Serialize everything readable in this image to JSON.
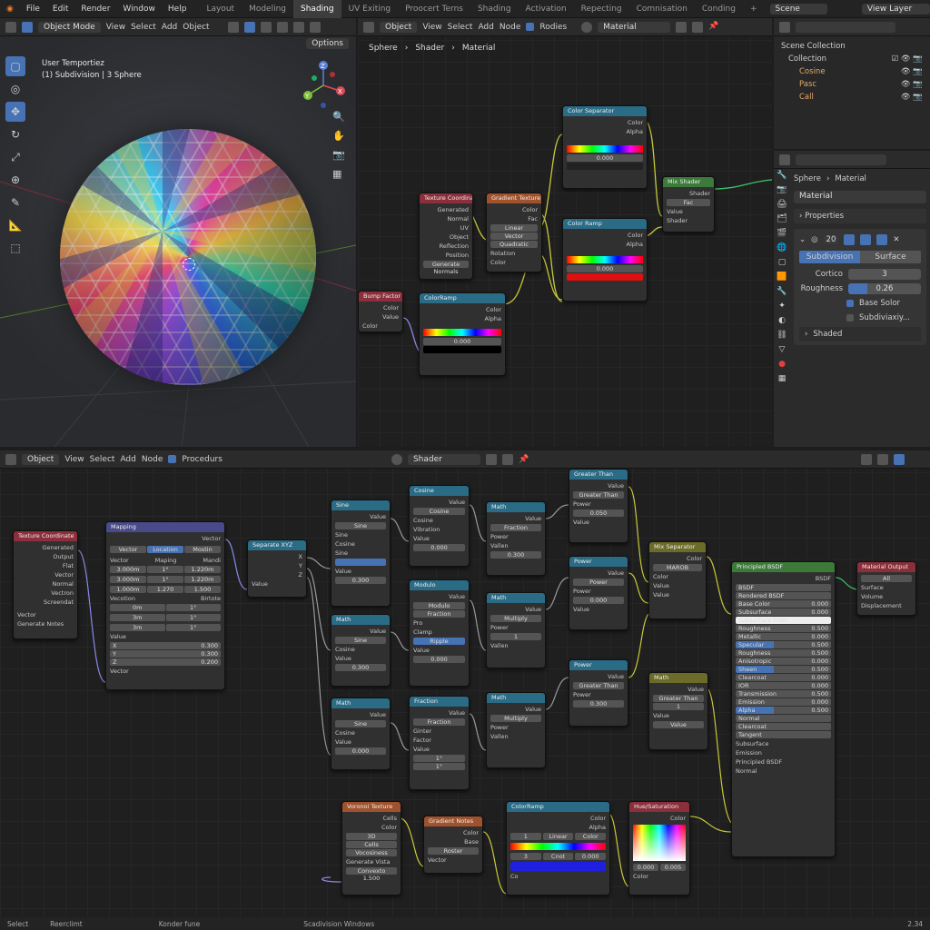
{
  "topbar": {
    "menus": [
      "File",
      "Edit",
      "Render",
      "Window",
      "Help"
    ],
    "workspaces": [
      "Layout",
      "Modeling",
      "Shading",
      "UV Exiting",
      "Proocert Terns",
      "Shading",
      "Activation",
      "Repecting",
      "Comnisation",
      "Conding"
    ],
    "active_workspace_index": 2,
    "plus": "+",
    "scene": "Scene",
    "view_layer": "View Layer"
  },
  "viewport": {
    "mode": "Object Mode",
    "menus": [
      "View",
      "Select",
      "Add",
      "Object"
    ],
    "options": "Options",
    "info_line1": "User Temportiez",
    "info_line2": "(1) Subdivision | 3 Sphere",
    "gizmo": {
      "x": "X",
      "y": "Y",
      "z": "Z"
    }
  },
  "shader_top": {
    "mode": "Object",
    "menus": [
      "View",
      "Select",
      "Add",
      "Node"
    ],
    "checkbox": "Rodies",
    "material": "Material",
    "breadcrumb": [
      "Sphere",
      "Shader",
      "Material"
    ]
  },
  "outliner": {
    "title": "Scene Collection",
    "collection": "Collection",
    "items": [
      "Cosine",
      "Pasc",
      "Call"
    ]
  },
  "properties": {
    "breadcrumb": [
      "Sphere",
      "Material"
    ],
    "material": "Material",
    "section": "Properties",
    "count": "20",
    "tabs": [
      "Subdivision",
      "Surface"
    ],
    "cortico_label": "Cortico",
    "cortico_value": "3",
    "roughness_label": "Roughness",
    "roughness_value": "0.26",
    "base_solor": "Base Solor",
    "subdiv": "Subdiviaxiy...",
    "shaded": "Shaded"
  },
  "shader_bottom": {
    "mode": "Object",
    "menus": [
      "View",
      "Select",
      "Add",
      "Node"
    ],
    "procedurs": "Procedurs",
    "shader": "Shader"
  },
  "top_nodes": {
    "n1": {
      "title": "Texture Coordinate",
      "rows": [
        "Generated",
        "Normal",
        "UV",
        "Object",
        "Reflection",
        "Position"
      ],
      "btn": "Generate Normals"
    },
    "n2": {
      "title": "Gradient Texture",
      "rows": [
        "Color",
        "Fac",
        "Linear",
        "Vector",
        "Quadratic",
        "Vector",
        "Rotation",
        "Color"
      ]
    },
    "n3": {
      "title": "Color Separator",
      "rows": [
        "Color",
        "Alpha"
      ],
      "ramp_vals": [
        "1",
        "Linear",
        "0.000"
      ]
    },
    "n4": {
      "title": "Color Ramp",
      "rows": [
        "Color",
        "Alpha"
      ],
      "ramp_vals": [
        "1",
        "Cnst",
        "0.000"
      ]
    },
    "n5": {
      "title": "ColorRamp",
      "rows": [
        "Color",
        "Alpha"
      ],
      "ramp_vals": [
        "1",
        "Base",
        "0.000"
      ]
    },
    "n6": {
      "title": "Mix Shader",
      "rows": [
        "Shader",
        "Fac",
        "Shader",
        "Value",
        "Shader"
      ]
    },
    "n7": {
      "title": "Bump Factor",
      "rows": [
        "Color",
        "Value",
        "Color"
      ]
    }
  },
  "bottom_nodes": {
    "texcoord": {
      "title": "Texture Coordinate",
      "rows": [
        "Generated",
        "Output",
        "Flat",
        "Vector",
        "Normal",
        "Vectron",
        "Screendat"
      ],
      "vector": "Vector",
      "chk": "Generate Notes"
    },
    "mapping": {
      "title": "Mapping",
      "out": "Vector",
      "tabs": [
        "Vector",
        "Location",
        "Mostin"
      ],
      "loc": "Vector",
      "rot": "Maping",
      "scale": "Mandi",
      "vals": [
        "3.000m",
        "3.000m",
        "1.000m",
        "1.270",
        "1.220m",
        "1.500"
      ],
      "rotlabel": "Vecotion",
      "scalelabel": "Birtote",
      "xyz": [
        "X",
        "Y",
        "Z"
      ],
      "rvals": [
        "0m",
        "3m",
        "3m"
      ],
      "svals": [
        "1°",
        "1°",
        "1°"
      ],
      "value": "Value",
      "fields": [
        "X",
        "Y",
        "Z"
      ],
      "fvals": [
        "0.300",
        "0.300",
        "0.200"
      ],
      "vector": "Vector"
    },
    "separate": {
      "title": "Separate XYZ",
      "out": [
        "X",
        "Y",
        "Z"
      ],
      "in": "Value"
    },
    "math_col1": [
      {
        "title": "Sine",
        "op": "Sine",
        "rows": [
          "Sine",
          "Cosine",
          "Sine"
        ],
        "val": "Value",
        "field": "0.300"
      },
      {
        "title": "Math",
        "op": "Sine",
        "rows": [
          "Cosine"
        ],
        "val": "Value",
        "field": "0.300"
      },
      {
        "title": "Math",
        "op": "Sine",
        "rows": [
          "Cosine"
        ],
        "val": "Value",
        "field": "0.000"
      }
    ],
    "math_col2": [
      {
        "title": "Cosine",
        "op": "Cosine",
        "rows": [
          "Cosine",
          "Vibration",
          "Value"
        ],
        "field": "0.000"
      },
      {
        "title": "Modulo",
        "op": "Modulo",
        "rows": [
          "Fraction",
          "Pro",
          "Clamp",
          "Ripple"
        ],
        "field": "0.000"
      },
      {
        "title": "Fraction",
        "op": "Fraction",
        "rows": [
          "Ginter",
          "Factor",
          "Value"
        ],
        "field": "1°"
      }
    ],
    "math_col3": [
      {
        "title": "Math",
        "op": "Fraction",
        "rows": [
          "Power",
          "Vallen"
        ],
        "field": "0.300"
      },
      {
        "title": "Math",
        "op": "Multiply",
        "rows": [
          "Power",
          "Vallen"
        ],
        "field": "1"
      },
      {
        "title": "Math",
        "op": "Multiply",
        "rows": [
          "Power",
          "Vallen"
        ],
        "field": ""
      }
    ],
    "compare": [
      {
        "title": "Greater Than",
        "op": "Greater Than",
        "rows": [
          "Power",
          "Value"
        ],
        "field": "0.050"
      },
      {
        "title": "Power",
        "op": "Power",
        "rows": [
          "Power",
          "Value"
        ],
        "field": "0.000"
      },
      {
        "title": "Power",
        "op": "Greater Than",
        "rows": [
          "Power",
          "Value"
        ],
        "field": "0.300"
      }
    ],
    "mix1": {
      "title": "Mix Separator",
      "rows": [
        "Color",
        "MAROB",
        "Color",
        "Value",
        "Value"
      ]
    },
    "mix2": {
      "title": "Math",
      "rows": [
        "Value",
        "Greater Than",
        "Value",
        "1",
        "Value"
      ]
    },
    "bsdf": {
      "title": "Principled BSDF",
      "out": "BSDF",
      "dist": "BSDF",
      "sub": "Rendered BSDF",
      "rows": [
        "Base Color",
        "Subsurface",
        "Subsurface Color",
        "Roughness",
        "Metallic",
        "Specular",
        "Roughness",
        "Anisotropic",
        "Sheen",
        "Clearcoat",
        "IOR",
        "Transmission",
        "Emission",
        "Alpha",
        "Normal",
        "Clearcoat",
        "Tangent"
      ],
      "vals": [
        "0.000",
        "0.000",
        "",
        "0.500",
        "0.000",
        "0.500",
        "0.500",
        "0.000",
        "0.500",
        "0.000",
        "0.000",
        "0.500",
        "0.000",
        "0.500",
        "",
        "",
        ""
      ],
      "extra": [
        "Subsurface",
        "Emission",
        "Principled BSDF",
        "Normal"
      ]
    },
    "output": {
      "title": "Material Output",
      "target": "All",
      "rows": [
        "Surface",
        "Volume",
        "Displacement"
      ]
    },
    "voronoi": {
      "title": "Voronoi Texture",
      "rows": [
        "Cells",
        "Color",
        "3D",
        "Cells",
        "Vocosiness"
      ],
      "btn": "Generate Vista",
      "field": "Convexto 1.500"
    },
    "gradient": {
      "title": "Gradient Notes",
      "rows": [
        "Color",
        "Base"
      ],
      "mode": "Roster",
      "vec": "Vector"
    },
    "ramp": {
      "title": "ColorRamp",
      "out": [
        "Color",
        "Alpha"
      ],
      "vals": [
        "1",
        "Linear",
        "Color"
      ],
      "vals2": [
        "3",
        "Cnot",
        "0.000"
      ],
      "in": "Co"
    },
    "hue": {
      "title": "Hue/Saturation",
      "out": "Color",
      "vals": [
        "0.000",
        "0.005"
      ],
      "in": "Color"
    }
  },
  "statusbar": {
    "items": [
      "Select",
      "Reerclimt",
      "Konder fune",
      "Scadivision Windows"
    ],
    "version": "2.34"
  }
}
